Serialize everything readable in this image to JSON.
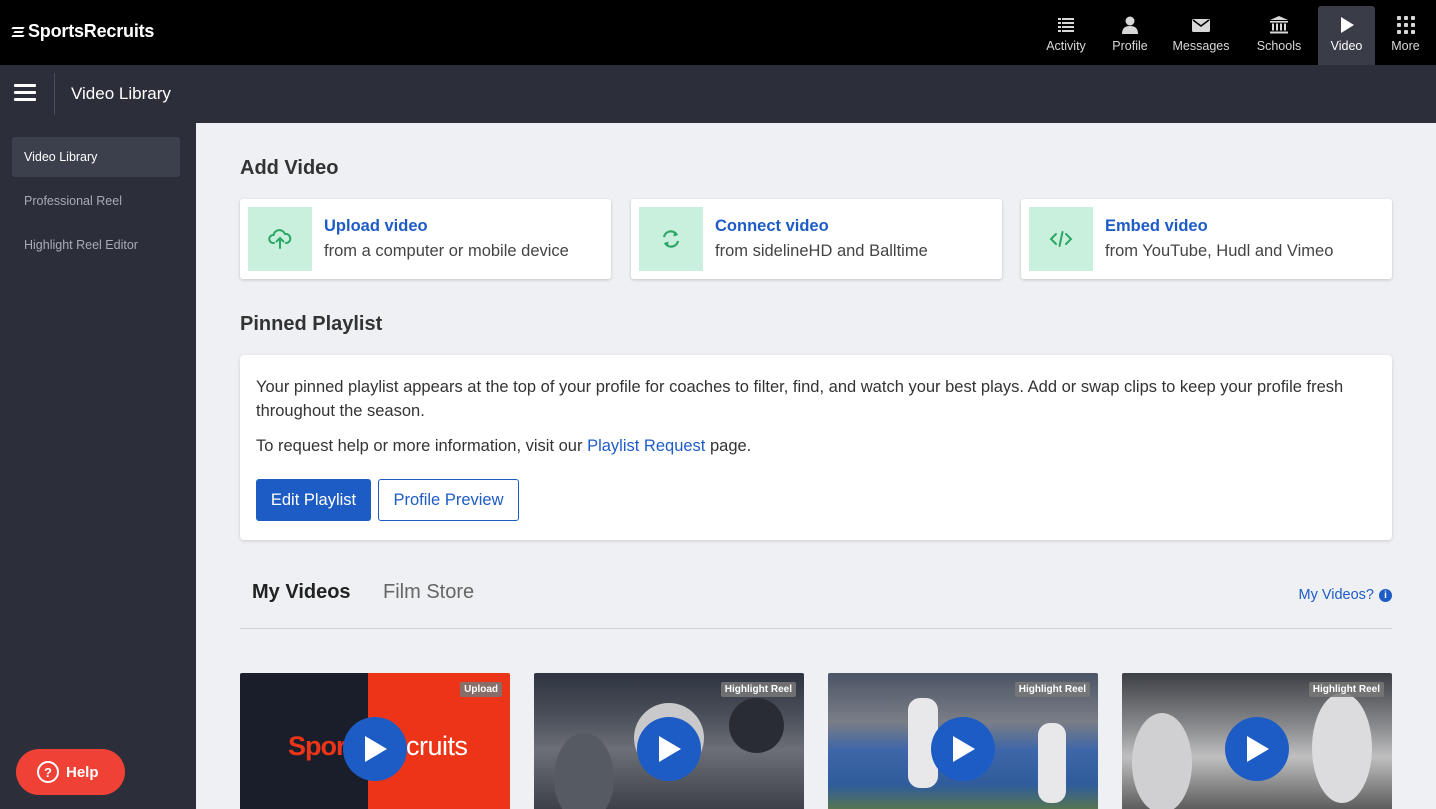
{
  "app": {
    "brand": "SportsRecruits"
  },
  "topnav": {
    "items": [
      {
        "label": "Activity",
        "icon": "list-icon"
      },
      {
        "label": "Profile",
        "icon": "person-icon"
      },
      {
        "label": "Messages",
        "icon": "envelope-icon"
      },
      {
        "label": "Schools",
        "icon": "building-icon"
      },
      {
        "label": "Video",
        "icon": "play-icon",
        "active": true
      },
      {
        "label": "More",
        "icon": "grid-icon"
      }
    ]
  },
  "subheader": {
    "title": "Video Library"
  },
  "sidebar": {
    "items": [
      {
        "label": "Video Library",
        "active": true
      },
      {
        "label": "Professional Reel"
      },
      {
        "label": "Highlight Reel Editor"
      }
    ],
    "help_label": "Help"
  },
  "add_video": {
    "heading": "Add Video",
    "cards": [
      {
        "title": "Upload video",
        "subtitle": "from a computer or mobile device",
        "icon": "cloud-upload-icon"
      },
      {
        "title": "Connect video",
        "subtitle": "from sidelineHD and Balltime",
        "icon": "refresh-icon"
      },
      {
        "title": "Embed video",
        "subtitle": "from YouTube, Hudl and Vimeo",
        "icon": "code-icon"
      }
    ]
  },
  "pinned": {
    "heading": "Pinned Playlist",
    "description": "Your pinned playlist appears at the top of your profile for coaches to filter, find, and watch your best plays. Add or swap clips to keep your profile fresh throughout the season.",
    "request_prefix": "To request help or more information, visit our ",
    "request_link": "Playlist Request",
    "request_suffix": " page.",
    "edit_label": "Edit Playlist",
    "preview_label": "Profile Preview"
  },
  "tabs": {
    "items": [
      {
        "label": "My Videos",
        "active": true
      },
      {
        "label": "Film Store"
      }
    ],
    "help_link": "My Videos?"
  },
  "videos": [
    {
      "badge": "Upload",
      "thumb_text_left": "Spor",
      "thumb_text_right": "cruits"
    },
    {
      "badge": "Highlight Reel"
    },
    {
      "badge": "Highlight Reel"
    },
    {
      "badge": "Highlight Reel"
    }
  ],
  "colors": {
    "accent": "#1e5cc5",
    "help": "#ef4136",
    "icon_bg": "#c9f0dc",
    "icon_fg": "#2aa766"
  }
}
